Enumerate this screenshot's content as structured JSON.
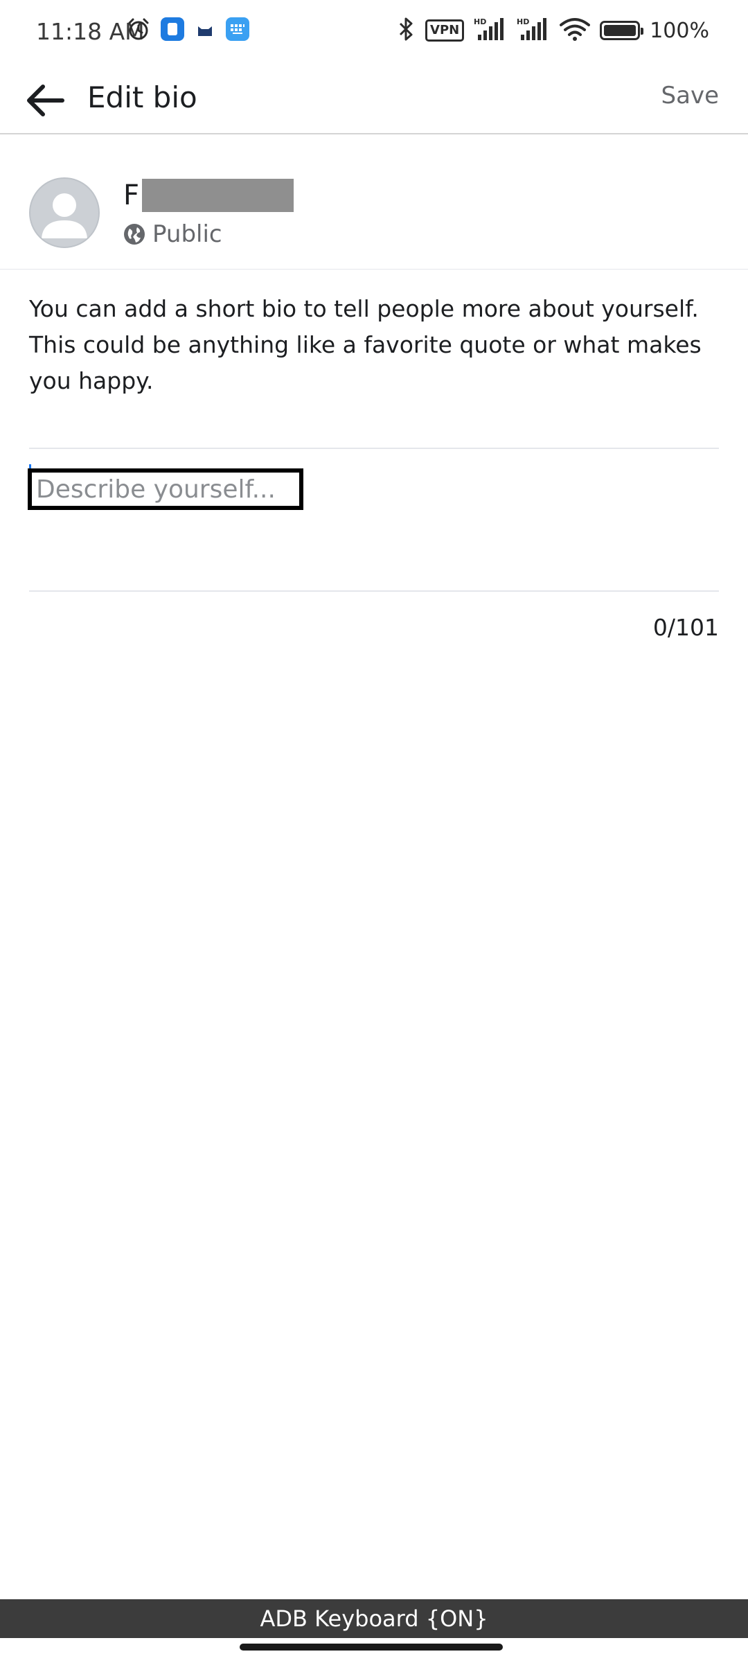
{
  "status_bar": {
    "time": "11:18 AM",
    "left_icons": [
      "alarm-icon",
      "blue-app-icon",
      "cat-app-icon",
      "keyboard-app-icon"
    ],
    "right_icons": [
      "bluetooth-icon",
      "vpn-icon",
      "hd-signal-icon",
      "hd-signal-icon",
      "wifi-icon",
      "battery-icon"
    ],
    "vpn_label": "VPN",
    "battery_level": "100%",
    "battery_text": "100%"
  },
  "app_bar": {
    "title": "Edit bio",
    "save_label": "Save",
    "back_icon": "arrow-left-icon"
  },
  "profile": {
    "name_visible": "F",
    "audience_label": "Public",
    "audience_icon": "globe-icon"
  },
  "bio": {
    "description": "You can add a short bio to tell people more about yourself. This could be anything like a favorite quote or what makes you happy.",
    "value": "",
    "placeholder": "Describe yourself...",
    "counter": "0/101"
  },
  "keyboard_bar": {
    "label": "ADB Keyboard {ON}"
  },
  "colors": {
    "accent": "#1877f2",
    "muted_text": "#65676b",
    "divider": "#e4e6eb"
  }
}
